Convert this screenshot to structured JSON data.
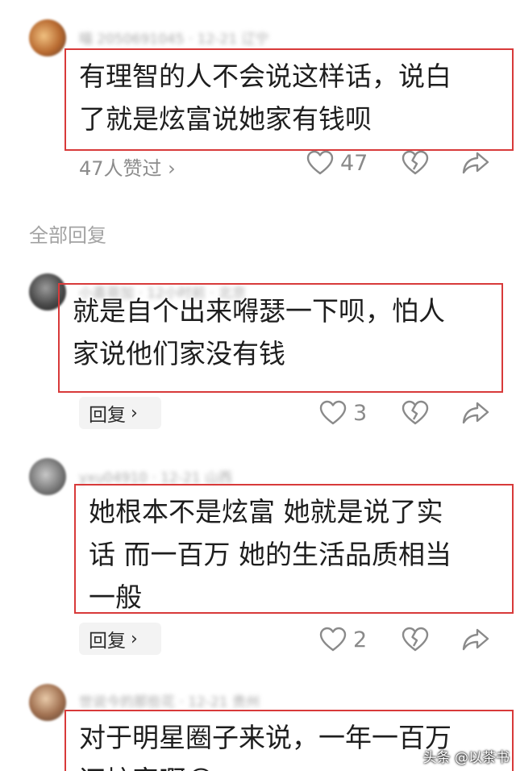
{
  "thread": {
    "top_comment": {
      "meta": "喵 2050691045 · 12-21 辽宁",
      "lines": [
        "有理智的人不会说这样话，说白",
        "了就是炫富说她家有钱呗"
      ],
      "likes_link": "47人赞过 ›",
      "like_count": "47"
    },
    "section_title": "全部回复",
    "replies": [
      {
        "meta": "小喜哥加 · 12小时前 · 北京",
        "lines": [
          "就是自个出来嘚瑟一下呗，怕人",
          "家说他们家没有钱"
        ],
        "reply_label": "回复",
        "like_count": "3"
      },
      {
        "meta": "yxu04910 · 12-21 山西",
        "lines": [
          "她根本不是炫富 她就是说了实",
          "话 而一百万 她的生活品质相当",
          "一般"
        ],
        "reply_label": "回复",
        "like_count": "2"
      },
      {
        "meta": "世说今的那些花 · 12-21 贵州",
        "lines": [
          "对于明星圈子来说，一年一百万",
          "还炫富啊😂"
        ]
      }
    ]
  },
  "icons": {
    "like": "heart-outline-icon",
    "dislike": "broken-heart-icon",
    "share": "share-arrow-icon",
    "chevron": "chevron-right-icon"
  },
  "colors": {
    "highlight_border": "#d83a3a",
    "muted_text": "#8c8c8c",
    "reply_button_bg": "#f3f3f3"
  },
  "watermark": "头条 @以茶书"
}
